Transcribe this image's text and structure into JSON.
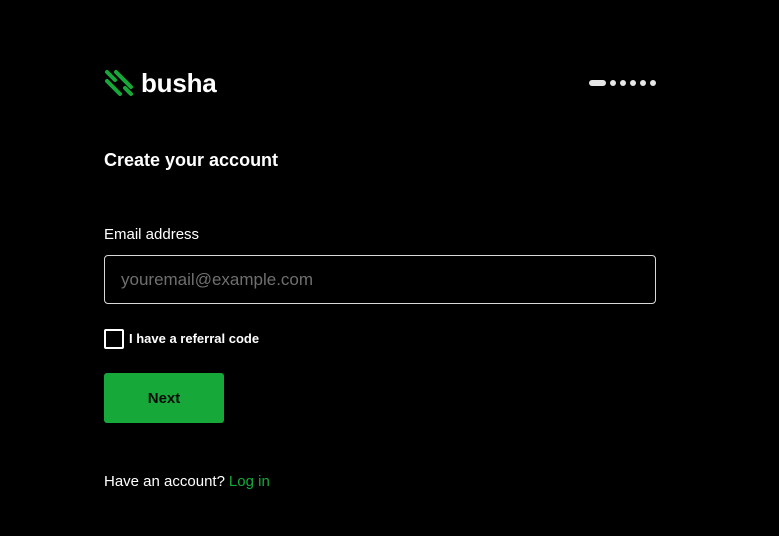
{
  "brand": {
    "name": "busha",
    "logo_icon": "busha-slash-logo-icon",
    "accent_color": "#16a93a"
  },
  "progress": {
    "current_step": 1,
    "total_steps": 6
  },
  "form": {
    "title": "Create your account",
    "email_label": "Email address",
    "email_placeholder": "youremail@example.com",
    "email_value": "",
    "referral_label": "I have a referral code",
    "referral_checked": false,
    "next_label": "Next"
  },
  "footer": {
    "prompt": "Have an account?",
    "login_label": "Log in"
  },
  "colors": {
    "background": "#000000",
    "text": "#ffffff",
    "button": "#16a93a",
    "input_border": "#d9d9d9",
    "placeholder": "#6f6f6f"
  }
}
